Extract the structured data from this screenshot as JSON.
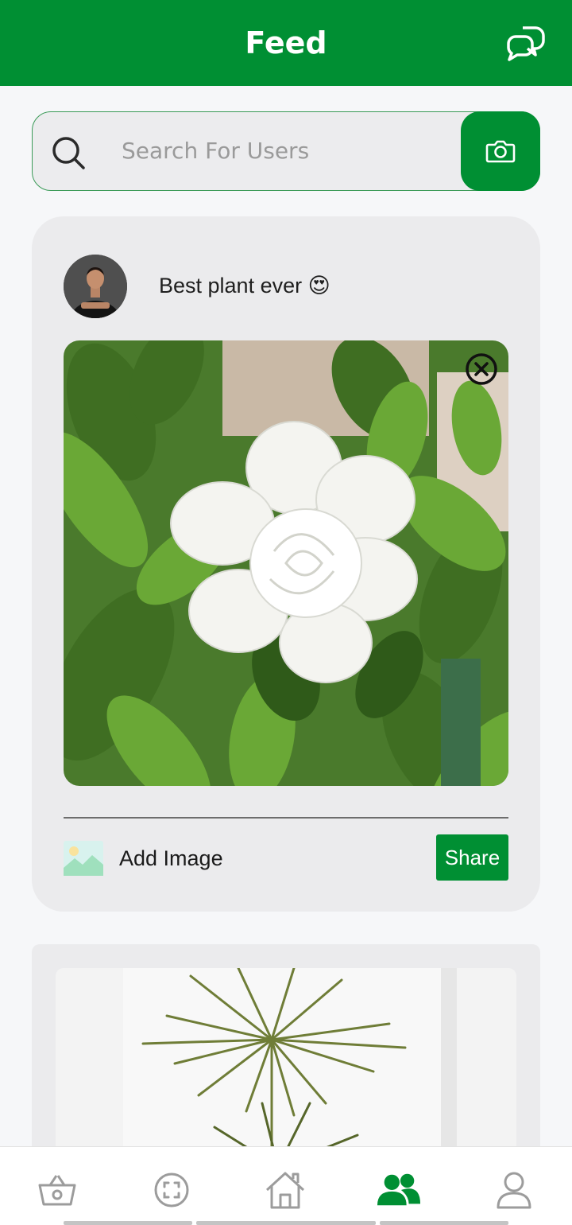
{
  "header": {
    "title": "Feed",
    "chat_icon": "chat-bubbles-icon"
  },
  "search": {
    "placeholder": "Search For Users",
    "value": "",
    "search_icon": "search-icon",
    "camera_icon": "camera-icon"
  },
  "composer": {
    "text": "Best plant ever 😍",
    "avatar_icon": "user-avatar",
    "photo": "white-gardenia-flower-photo",
    "remove_icon": "close-circle-icon",
    "add_image_icon": "image-icon",
    "add_image_label": "Add Image",
    "share_label": "Share"
  },
  "feed": {
    "next_post_photo": "dracaena-plant-photo"
  },
  "bottom_nav": {
    "items": [
      {
        "icon": "basket-icon",
        "active": false
      },
      {
        "icon": "scan-icon",
        "active": false
      },
      {
        "icon": "home-icon",
        "active": false
      },
      {
        "icon": "community-icon",
        "active": true
      },
      {
        "icon": "profile-icon",
        "active": false
      }
    ]
  },
  "colors": {
    "brand": "#008f33",
    "background": "#f6f7f9",
    "card": "#ebebed",
    "inactive_icon": "#9c9c9c"
  }
}
